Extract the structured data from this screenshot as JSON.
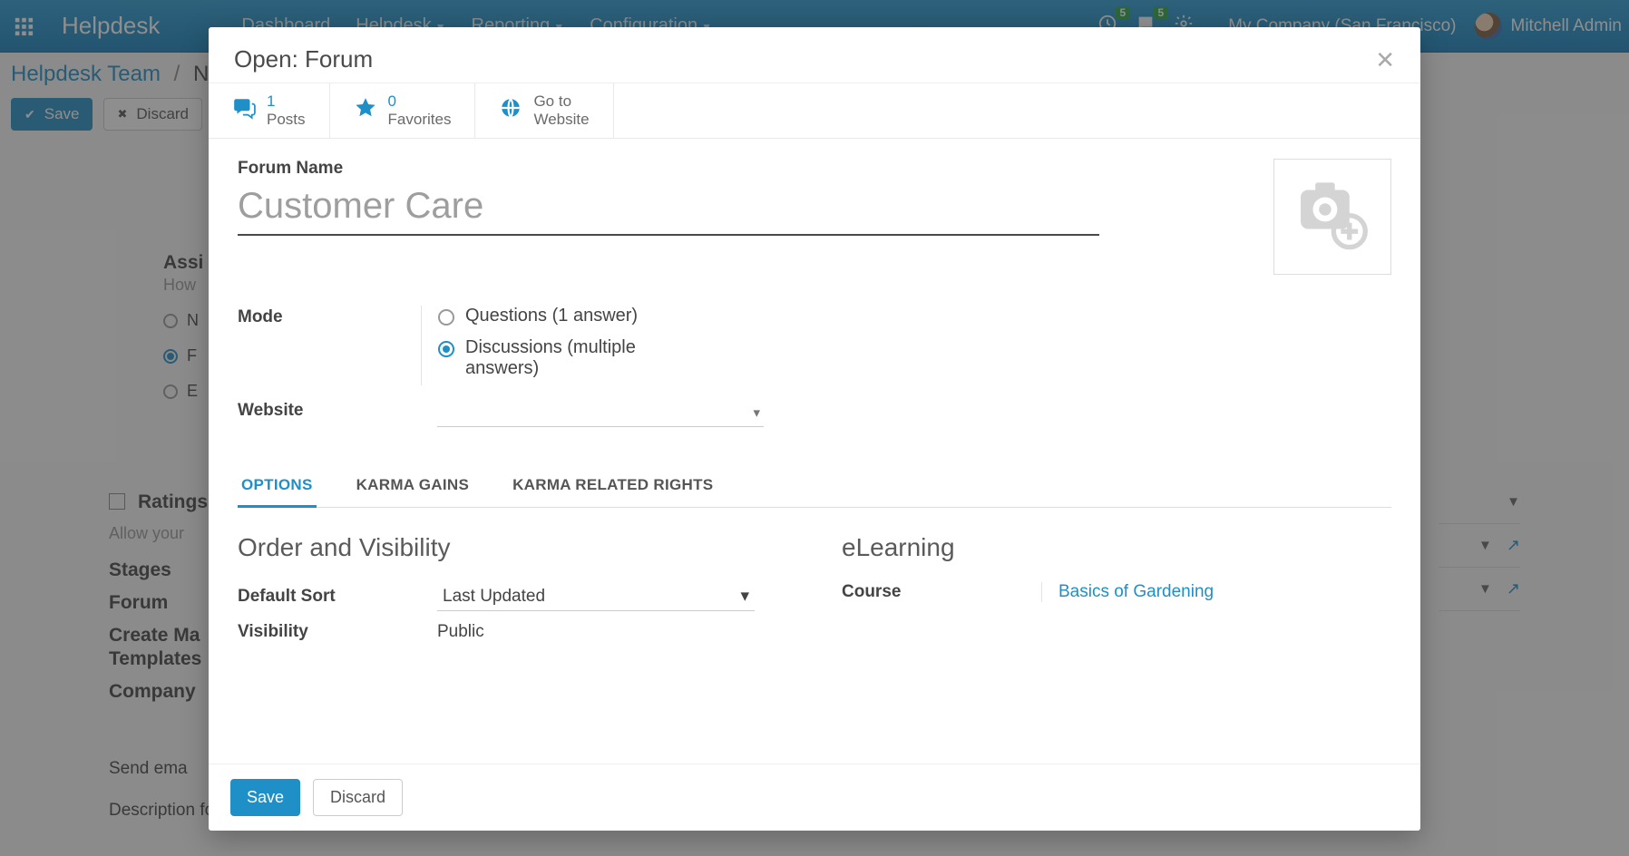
{
  "navbar": {
    "brand": "Helpdesk",
    "menus": [
      "Dashboard",
      "Helpdesk",
      "Reporting",
      "Configuration"
    ],
    "activity_badge": "5",
    "discuss_badge": "5",
    "company": "My Company (San Francisco)",
    "user": "Mitchell Admin"
  },
  "breadcrumb": {
    "root": "Helpdesk Team",
    "current_initial": "N"
  },
  "bg_toolbar": {
    "save": "Save",
    "discard": "Discard"
  },
  "bg_form": {
    "assign_label": "Assi",
    "assign_sub": "How",
    "radio_n": "N",
    "radio_f": "F",
    "radio_e": "E",
    "ratings": "Ratings",
    "allow": "Allow your",
    "stages": "Stages",
    "forum": "Forum",
    "create_ma": "Create Ma",
    "templates": "Templates",
    "company": "Company",
    "send_email": "Send ema",
    "desc_portal": "Description for customer portal"
  },
  "modal": {
    "title": "Open: Forum",
    "stats": {
      "posts_n": "1",
      "posts_l": "Posts",
      "fav_n": "0",
      "fav_l": "Favorites",
      "goto_l1": "Go to",
      "goto_l2": "Website"
    },
    "form": {
      "name_label": "Forum Name",
      "name_value": "Customer Care",
      "mode_label": "Mode",
      "mode_q": "Questions (1 answer)",
      "mode_d": "Discussions (multiple answers)",
      "website_label": "Website"
    },
    "tabs": [
      "OPTIONS",
      "KARMA GAINS",
      "KARMA RELATED RIGHTS"
    ],
    "options": {
      "order_h": "Order and Visibility",
      "default_sort_l": "Default Sort",
      "default_sort_v": "Last Updated",
      "visibility_l": "Visibility",
      "visibility_v": "Public",
      "elearning_h": "eLearning",
      "course_l": "Course",
      "course_v": "Basics of Gardening"
    },
    "footer": {
      "save": "Save",
      "discard": "Discard"
    }
  }
}
